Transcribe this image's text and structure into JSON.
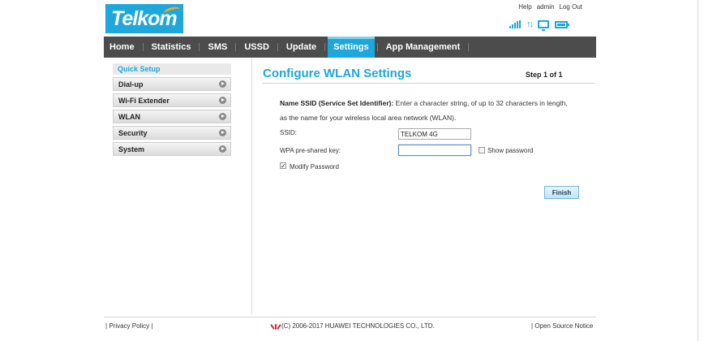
{
  "brand": {
    "logo_text": "Telkom"
  },
  "top_links": {
    "help": "Help",
    "user": "admin",
    "logout": "Log Out"
  },
  "nav": {
    "items": [
      "Home",
      "Statistics",
      "SMS",
      "USSD",
      "Update",
      "Settings",
      "App Management"
    ],
    "active": "Settings"
  },
  "sidebar": {
    "quick_setup": "Quick Setup",
    "items": [
      "Dial-up",
      "Wi-Fi Extender",
      "WLAN",
      "Security",
      "System"
    ]
  },
  "content": {
    "title": "Configure WLAN Settings",
    "step": "Step 1 of 1",
    "desc_bold": "Name SSID (Service Set Identifier):",
    "desc_text": " Enter a character string, of up to 32 characters in length, as the name for your wireless local area network (WLAN).",
    "ssid_label": "SSID:",
    "ssid_value": "TELKOM 4G",
    "wpa_label": "WPA pre-shared key:",
    "wpa_value": "",
    "show_password_label": "Show password",
    "show_password_checked": false,
    "modify_password_label": "Modify Password",
    "modify_password_checked": true,
    "finish_label": "Finish"
  },
  "footer": {
    "privacy": "Privacy Policy",
    "copyright": "(C) 2006-2017 HUAWEI TECHNOLOGIES CO., LTD.",
    "open_source": "Open Source Notice"
  },
  "colors": {
    "accent": "#1da7da",
    "nav_bg": "#4c4c4c",
    "brand_orange": "#f6a623",
    "huawei_red": "#d8262e"
  },
  "icons": [
    "signal-icon",
    "data-arrows-icon",
    "monitor-icon",
    "battery-icon",
    "huawei-logo-icon",
    "sidebar-arrow-icon"
  ]
}
